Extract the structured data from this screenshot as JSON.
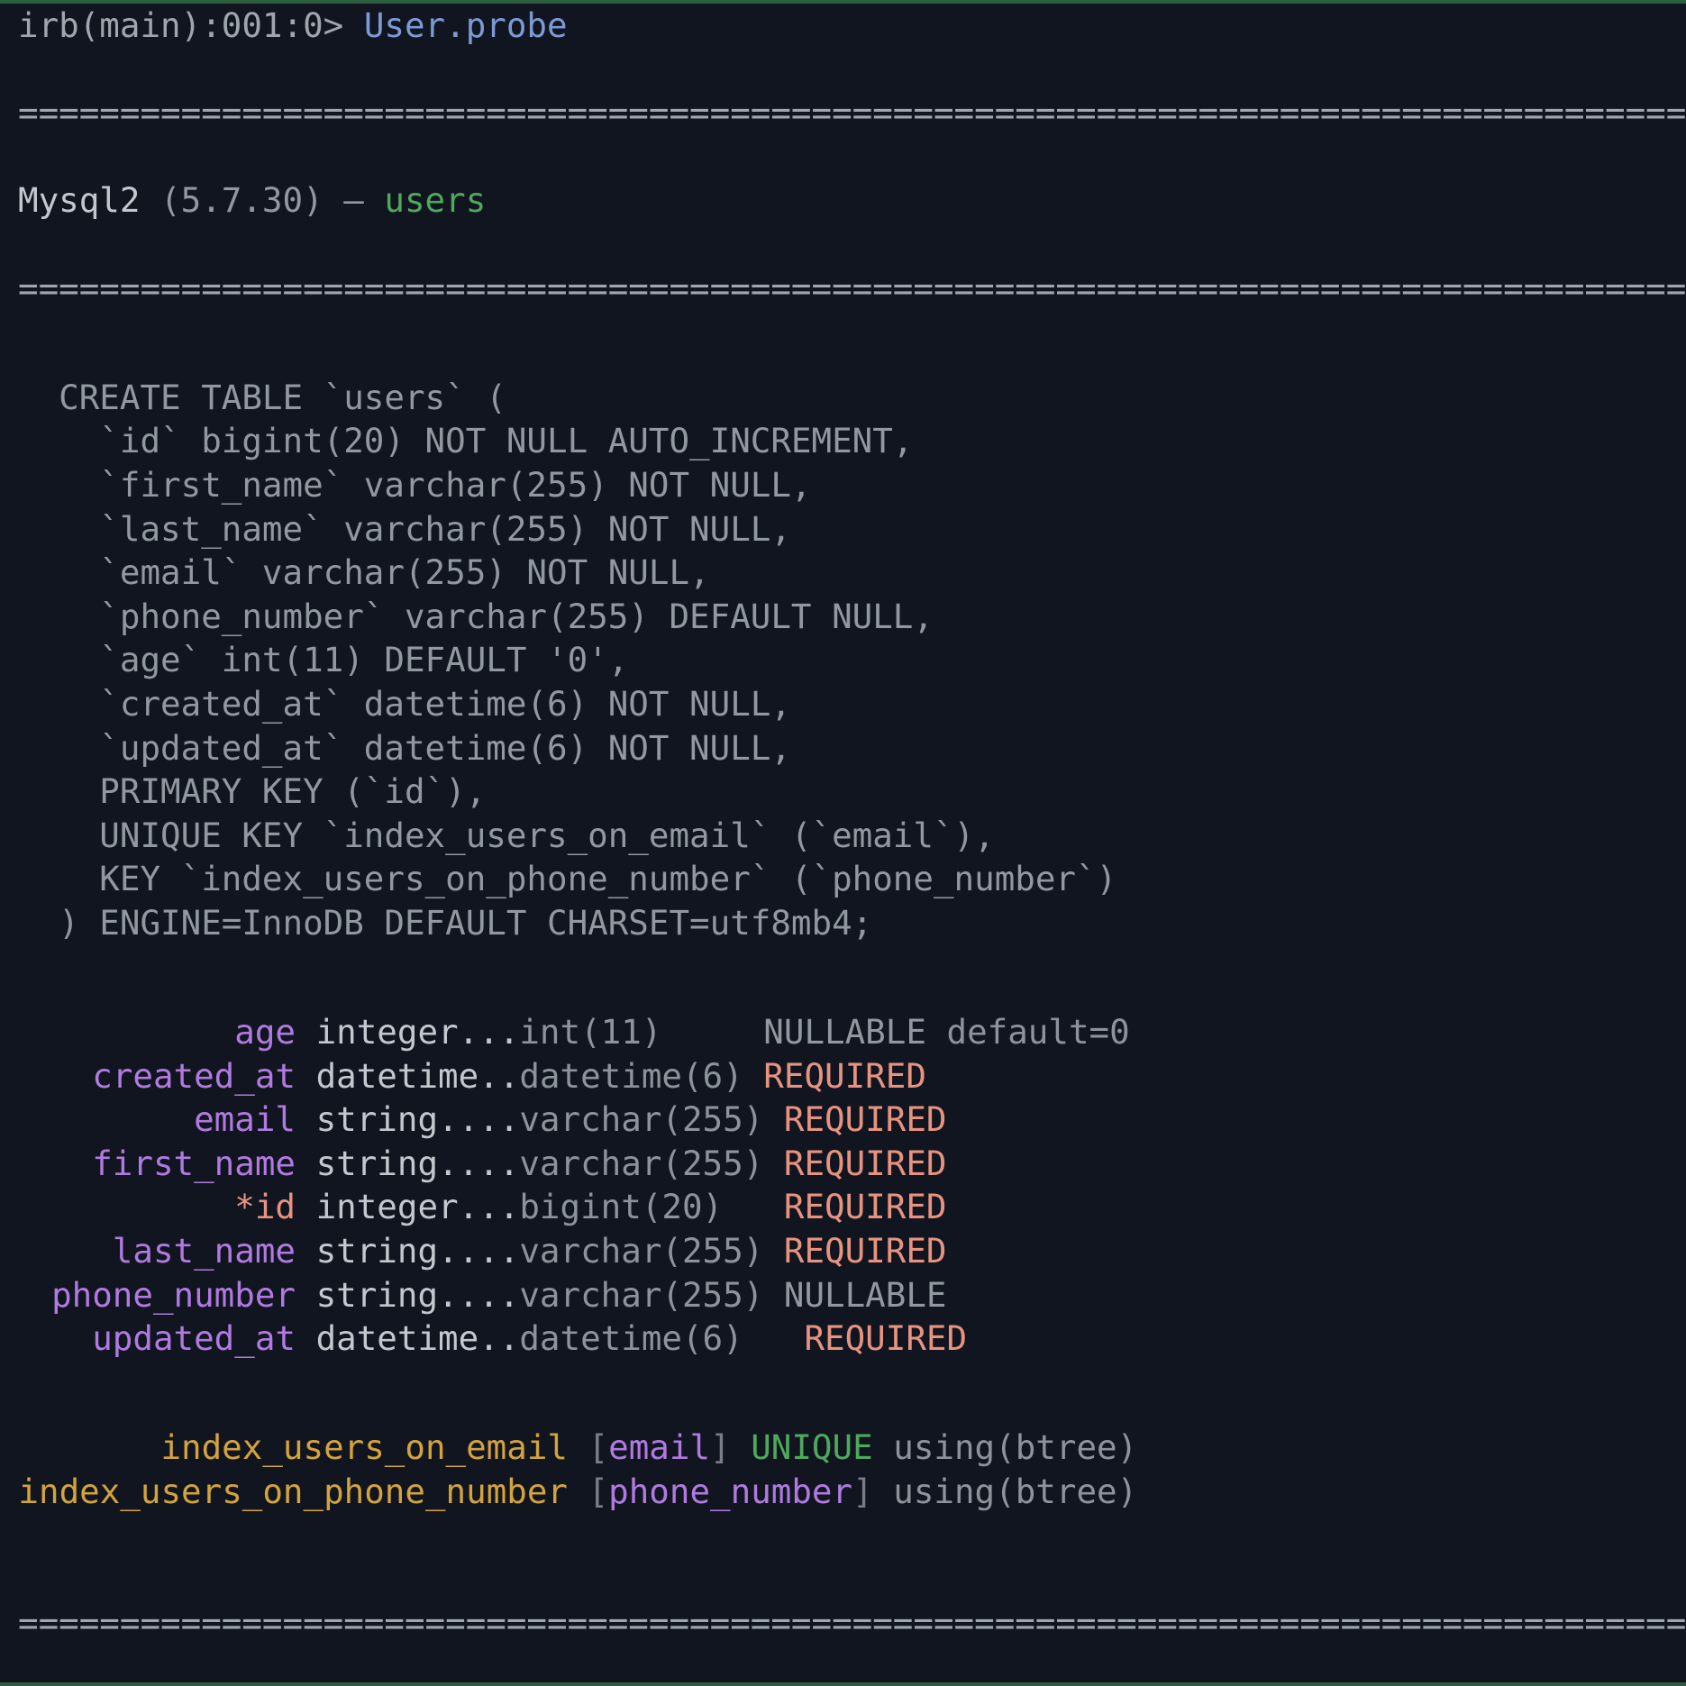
{
  "terminal": {
    "background_color": "#111520",
    "border_color": "#2e5c3f",
    "default_text_color": "#a0a6ad"
  },
  "prompt": {
    "prefix": "irb(main):001:0> ",
    "command": "User.probe",
    "command_color": "#7c9ad4"
  },
  "separator": "===========================================================================================",
  "header": {
    "adapter": "Mysql2",
    "version": "(5.7.30)",
    "dash": "—",
    "table_name": "users",
    "table_name_color": "#4fa85c"
  },
  "create_table": {
    "lines": [
      "  CREATE TABLE `users` (",
      "    `id` bigint(20) NOT NULL AUTO_INCREMENT,",
      "    `first_name` varchar(255) NOT NULL,",
      "    `last_name` varchar(255) NOT NULL,",
      "    `email` varchar(255) NOT NULL,",
      "    `phone_number` varchar(255) DEFAULT NULL,",
      "    `age` int(11) DEFAULT '0',",
      "    `created_at` datetime(6) NOT NULL,",
      "    `updated_at` datetime(6) NOT NULL,",
      "    PRIMARY KEY (`id`),",
      "    UNIQUE KEY `index_users_on_email` (`email`),",
      "    KEY `index_users_on_phone_number` (`phone_number`)",
      "  ) ENGINE=InnoDB DEFAULT CHARSET=utf8mb4;"
    ]
  },
  "columns": {
    "rows": [
      {
        "name": "age",
        "name_color": "#b07ae0",
        "ruby_type": "integer...",
        "sql_type": "int(11)",
        "pad": "     ",
        "nullability": "NULLABLE",
        "nullability_color": "#9298a0",
        "extra": " default=0",
        "primary_key": false
      },
      {
        "name": "created_at",
        "name_color": "#b07ae0",
        "ruby_type": "datetime..",
        "sql_type": "datetime(6)",
        "pad": " ",
        "nullability": "REQUIRED",
        "nullability_color": "#e79380",
        "extra": "",
        "primary_key": false
      },
      {
        "name": "email",
        "name_color": "#b07ae0",
        "ruby_type": "string....",
        "sql_type": "varchar(255)",
        "pad": " ",
        "nullability": "REQUIRED",
        "nullability_color": "#e79380",
        "extra": "",
        "primary_key": false
      },
      {
        "name": "first_name",
        "name_color": "#b07ae0",
        "ruby_type": "string....",
        "sql_type": "varchar(255)",
        "pad": " ",
        "nullability": "REQUIRED",
        "nullability_color": "#e79380",
        "extra": "",
        "primary_key": false
      },
      {
        "name": "*id",
        "name_color": "#e79380",
        "ruby_type": "integer...",
        "sql_type": "bigint(20)",
        "pad": "   ",
        "nullability": "REQUIRED",
        "nullability_color": "#e79380",
        "extra": "",
        "primary_key": true
      },
      {
        "name": "last_name",
        "name_color": "#b07ae0",
        "ruby_type": "string....",
        "sql_type": "varchar(255)",
        "pad": " ",
        "nullability": "REQUIRED",
        "nullability_color": "#e79380",
        "extra": "",
        "primary_key": false
      },
      {
        "name": "phone_number",
        "name_color": "#b07ae0",
        "ruby_type": "string....",
        "sql_type": "varchar(255)",
        "pad": " ",
        "nullability": "NULLABLE",
        "nullability_color": "#9298a0",
        "extra": "",
        "primary_key": false
      },
      {
        "name": "updated_at",
        "name_color": "#b07ae0",
        "ruby_type": "datetime..",
        "sql_type": "datetime(6)",
        "pad": "   ",
        "nullability": "REQUIRED",
        "nullability_color": "#e79380",
        "extra": "",
        "primary_key": false
      }
    ]
  },
  "indexes": {
    "rows": [
      {
        "name": "index_users_on_email",
        "name_color": "#d3a33c",
        "open_bracket": "[",
        "columns": "email",
        "close_bracket": "]",
        "unique_label": " UNIQUE",
        "unique_color": "#4fa85c",
        "using": " using(btree)"
      },
      {
        "name": "index_users_on_phone_number",
        "name_color": "#d3a33c",
        "open_bracket": "[",
        "columns": "phone_number",
        "close_bracket": "]",
        "unique_label": "",
        "unique_color": "#4fa85c",
        "using": " using(btree)"
      }
    ]
  }
}
